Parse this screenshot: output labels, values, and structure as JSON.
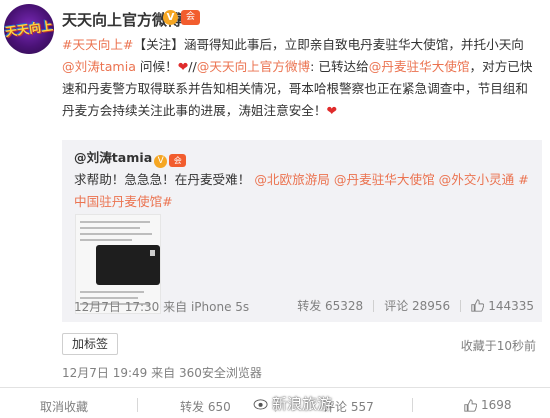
{
  "post": {
    "username": "天天向上官方微博",
    "v_badge": "V",
    "vip_badge": "会",
    "text_parts": {
      "t1": "#天天向上#",
      "t2": "【关注】涵哥得知此事后，立即亲自致电丹麦驻华大使馆，并托小天向",
      "t3": "@刘涛tamia",
      "t4": " 问候！",
      "t5": "❤",
      "t6": "//",
      "t7": "@天天向上官方微博",
      "t8": ": 已转达给",
      "t9": "@丹麦驻华大使馆",
      "t10": "，对方已快速和丹麦警方取得联系并告知相关情况，哥本哈根警察也正在紧急调查中，节目组和丹麦方会持续关注此事的进展，涛姐注意安全！",
      "t11": "❤"
    }
  },
  "repost": {
    "username": "@刘涛tamia",
    "v_badge": "V",
    "vip_badge": "会",
    "text_parts": {
      "r1": "求帮助！急急急！在丹麦受难！",
      "r2": "@北欧旅游局",
      "r3": "@丹麦驻华大使馆",
      "r4": "@外交小灵通",
      "r5": "#中国驻丹麦使馆#"
    },
    "time": "12月7日 17:30",
    "source": "来自 iPhone 5s",
    "repost_label": "转发 65328",
    "comment_label": "评论 28956",
    "like_count": "144335"
  },
  "tag_button": "加标签",
  "favorited": "收藏于10秒前",
  "meta": {
    "time": "12月7日 19:49",
    "source": "来自 360安全浏览器"
  },
  "bottom_bar": {
    "unfavorite": "取消收藏",
    "repost": "转发 650",
    "comment": "评论 557",
    "like_count": "1698"
  },
  "watermark": "新浪旅游",
  "avatar_text": "天天向上",
  "colors": {
    "link": "#eb7350",
    "text": "#333333",
    "muted": "#808080",
    "repost_bg": "#f2f2f5"
  },
  "icons": [
    "verified-icon",
    "vip-icon",
    "heart-icon",
    "thumbs-up-icon",
    "weibo-eye-icon"
  ]
}
